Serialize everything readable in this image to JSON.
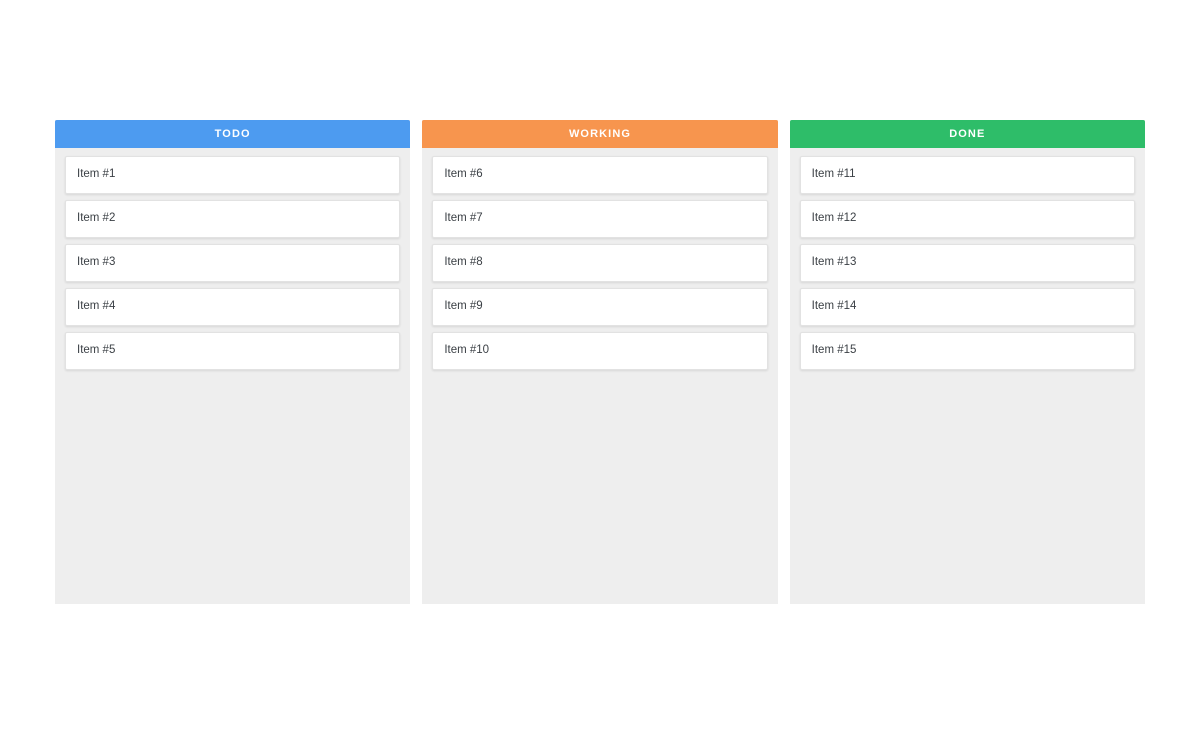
{
  "board": {
    "background_color": "#ffffff",
    "column_body_color": "#eeeeee",
    "columns": [
      {
        "id": "todo",
        "title": "TODO",
        "accent_color": "#4d9bf0",
        "cards": [
          {
            "label": "Item #1"
          },
          {
            "label": "Item #2"
          },
          {
            "label": "Item #3"
          },
          {
            "label": "Item #4"
          },
          {
            "label": "Item #5"
          }
        ]
      },
      {
        "id": "working",
        "title": "WORKING",
        "accent_color": "#f7954e",
        "cards": [
          {
            "label": "Item #6"
          },
          {
            "label": "Item #7"
          },
          {
            "label": "Item #8"
          },
          {
            "label": "Item #9"
          },
          {
            "label": "Item #10"
          }
        ]
      },
      {
        "id": "done",
        "title": "DONE",
        "accent_color": "#2ebd69",
        "cards": [
          {
            "label": "Item #11"
          },
          {
            "label": "Item #12"
          },
          {
            "label": "Item #13"
          },
          {
            "label": "Item #14"
          },
          {
            "label": "Item #15"
          }
        ]
      }
    ]
  }
}
